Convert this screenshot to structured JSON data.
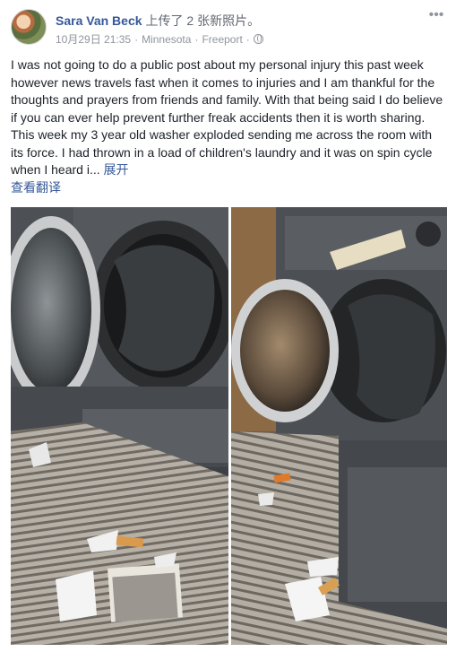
{
  "post": {
    "author": "Sara Van Beck",
    "action_text": "上传了 2 张新照片。",
    "date": "10月29日 21:35",
    "location_1": "Minnesota",
    "location_2": "Freeport",
    "privacy_icon": "globe-icon",
    "more_icon": "more-options-icon",
    "more_glyph": "•••",
    "text": "I was not going to do a public post about my personal injury this past week however news travels fast when it comes to injuries and I am thankful for the thoughts and prayers from friends and family. With that being said I do believe if you can ever help prevent further freak accidents then it is worth sharing. This week my 3 year old washer exploded sending me across the room with its force. I had thrown in a load of children's laundry and it was on spin cycle when I heard i...",
    "see_more": "展开",
    "translate": "查看翻译"
  },
  "photos": [
    {
      "icon": "washer-photo-1"
    },
    {
      "icon": "washer-photo-2"
    }
  ],
  "colors": {
    "link": "#365899",
    "meta": "#90949c",
    "text": "#1d2129"
  }
}
